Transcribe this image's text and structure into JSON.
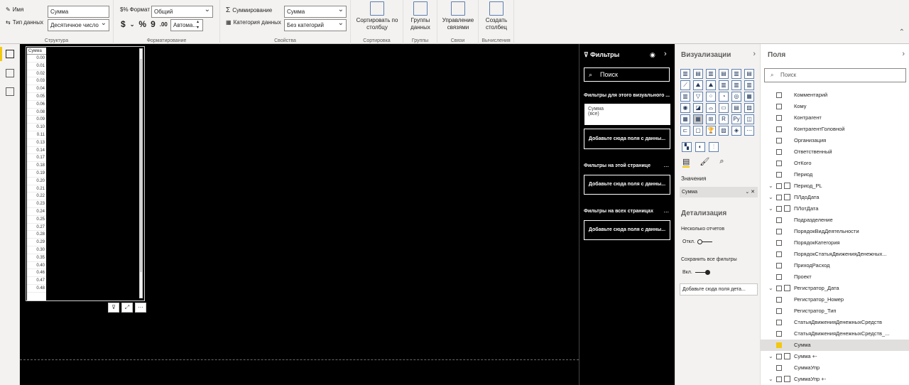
{
  "ribbon": {
    "structure": {
      "name_label": "Имя",
      "name_value": "Сумма",
      "datatype_label": "Тип данных",
      "datatype_value": "Десятичное число",
      "group_label": "Структура"
    },
    "formatting": {
      "format_label": "Формат",
      "format_value": "Общий",
      "currency_symbol": "$",
      "percent_symbol": "%",
      "comma_symbol": "9",
      "decimals_symbol": ".00",
      "auto_value": "Автома...",
      "group_label": "Форматирование"
    },
    "properties": {
      "summarization_label": "Суммирование",
      "summarization_value": "Сумма",
      "category_label": "Категория данных",
      "category_value": "Без категорий",
      "group_label": "Свойства"
    },
    "sort": {
      "button_line1": "Сортировать по",
      "button_line2": "столбцу",
      "group_label": "Сортировка"
    },
    "groups": {
      "button_line1": "Группы",
      "button_line2": "данных",
      "group_label": "Группы"
    },
    "relations": {
      "button_line1": "Управление",
      "button_line2": "связями",
      "group_label": "Связи"
    },
    "calc": {
      "button_line1": "Создать",
      "button_line2": "столбец",
      "group_label": "Вычисления"
    }
  },
  "table": {
    "header": "Сумма",
    "values": [
      "0.00",
      "0.01",
      "0.02",
      "0.03",
      "0.04",
      "0.05",
      "0.06",
      "0.08",
      "0.09",
      "0.10",
      "0.11",
      "0.13",
      "0.14",
      "0.17",
      "0.18",
      "0.19",
      "0.20",
      "0.21",
      "0.22",
      "0.23",
      "0.24",
      "0.25",
      "0.27",
      "0.28",
      "0.29",
      "0.30",
      "0.35",
      "0.40",
      "0.46",
      "0.47",
      "0.48"
    ]
  },
  "filters": {
    "title": "Фильтры",
    "search_placeholder": "Поиск",
    "visual_section": "Фильтры для этого визуального ...",
    "card_field": "Сумма",
    "card_value": "(все)",
    "add_field_visual": "Добавьте сюда поля с данны...",
    "page_section": "Фильтры на этой странице",
    "add_field_page": "Добавьте сюда поля с данны...",
    "all_pages_section": "Фильтры на всех страницах",
    "add_field_all": "Добавьте сюда поля с данны...",
    "more": "..."
  },
  "visualizations": {
    "title": "Визуализации",
    "values_label": "Значения",
    "values_field": "Сумма",
    "drillthrough_title": "Детализация",
    "cross_report_label": "Несколько отчетов",
    "cross_report_state": "Откл.",
    "keep_filters_label": "Сохранить все фильтры",
    "keep_filters_state": "Вкл.",
    "drillthrough_drop": "Добавьте сюда поля детa..."
  },
  "fields": {
    "title": "Поля",
    "search_placeholder": "Поиск",
    "items": [
      {
        "label": "Комментарий",
        "type": "field",
        "checked": false
      },
      {
        "label": "Кому",
        "type": "field",
        "checked": false
      },
      {
        "label": "Контрагент",
        "type": "field",
        "checked": false
      },
      {
        "label": "КонтрагентГоловной",
        "type": "field",
        "checked": false
      },
      {
        "label": "Организация",
        "type": "field",
        "checked": false
      },
      {
        "label": "Ответственный",
        "type": "field",
        "checked": false
      },
      {
        "label": "ОтКого",
        "type": "field",
        "checked": false
      },
      {
        "label": "Период",
        "type": "field",
        "checked": false
      },
      {
        "label": "Период_PL",
        "type": "hierarchy",
        "checked": false
      },
      {
        "label": "ПЛдоДата",
        "type": "hierarchy",
        "checked": false
      },
      {
        "label": "ПЛотДата",
        "type": "hierarchy",
        "checked": false
      },
      {
        "label": "Подразделение",
        "type": "field",
        "checked": false
      },
      {
        "label": "ПорядокВидДеятельности",
        "type": "field",
        "checked": false
      },
      {
        "label": "ПорядокКатегория",
        "type": "field",
        "checked": false
      },
      {
        "label": "ПорядокСтатьяДвиженияДенежных...",
        "type": "field",
        "checked": false
      },
      {
        "label": "ПриходРасход",
        "type": "field",
        "checked": false
      },
      {
        "label": "Проект",
        "type": "field",
        "checked": false
      },
      {
        "label": "Регистратор_Дата",
        "type": "hierarchy",
        "checked": false
      },
      {
        "label": "Регистратор_Номер",
        "type": "field",
        "checked": false
      },
      {
        "label": "Регистратор_Тип",
        "type": "field",
        "checked": false
      },
      {
        "label": "СтатьяДвиженияДенежныхСредств",
        "type": "field",
        "checked": false
      },
      {
        "label": "СтатьяДвиженияДенежныхСредств_...",
        "type": "field",
        "checked": false
      },
      {
        "label": "Сумма",
        "type": "field",
        "checked": true
      },
      {
        "label": "Сумма +-",
        "type": "table",
        "checked": false
      },
      {
        "label": "СуммаУпр",
        "type": "field",
        "checked": false
      },
      {
        "label": "СуммаУпр +-",
        "type": "table",
        "checked": false
      }
    ]
  }
}
